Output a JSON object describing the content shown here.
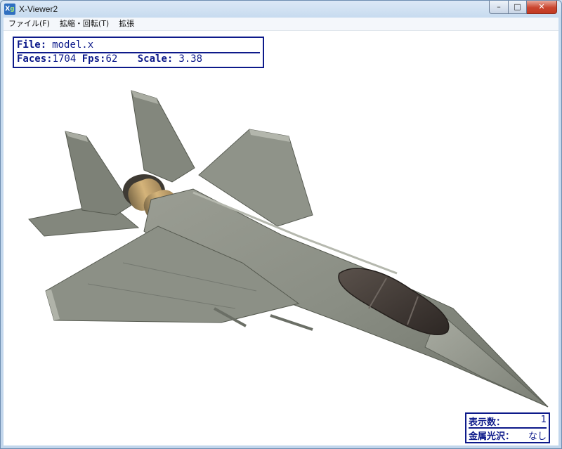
{
  "window": {
    "title": "X-Viewer2",
    "icon_text": "Xg",
    "minimize_glyph": "–",
    "maximize_glyph": "□",
    "close_glyph": "✕"
  },
  "menu": {
    "items": [
      {
        "label": "ファイル(F)"
      },
      {
        "label": "拡縮・回転(T)"
      },
      {
        "label": "拡張"
      }
    ]
  },
  "info": {
    "file_label": "File:",
    "file_value": "model.x",
    "faces_label": "Faces:",
    "faces_value": "1704",
    "fps_label": "Fps:",
    "fps_value": "62",
    "scale_label": "Scale:",
    "scale_value": "3.38"
  },
  "status": {
    "count_label": "表示数：",
    "count_value": "1",
    "metal_label": "金属光沢：",
    "metal_value": "なし"
  },
  "colors": {
    "overlay_blue": "#0d1a8a",
    "jet_body": "#8a8e84",
    "jet_dark": "#55594f",
    "jet_light": "#b2b5ab",
    "canopy": "#3a332f",
    "engine": "#c2a16a"
  }
}
